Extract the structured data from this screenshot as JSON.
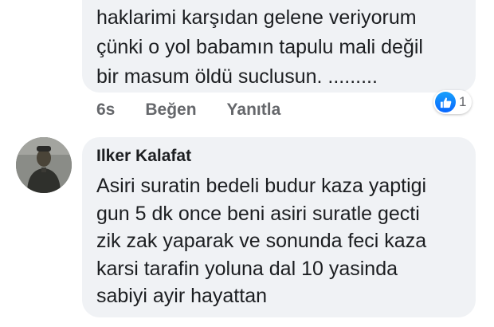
{
  "comment1": {
    "text": "haklarimi karşıdan gelene veriyorum\nçünki o yol babamın tapulu mali değil\nbir masum öldü  suclusun. .........",
    "time": "6s",
    "like_label": "Beğen",
    "reply_label": "Yanıtla",
    "reaction_count": "1",
    "reaction_icon": "thumbs-up-icon"
  },
  "comment2": {
    "author": "Ilker Kalafat",
    "text": "Asiri suratin bedeli budur kaza yaptigi\ngun 5 dk once beni asiri suratle gecti\nzik zak yaparak ve sonunda feci kaza\nkarsi tarafin yoluna dal 10 yasinda\nsabiyi ayir hayattan"
  },
  "colors": {
    "bubble": "#f0f2f5",
    "secondary_text": "#65676b",
    "like_blue": "#0866ff"
  }
}
